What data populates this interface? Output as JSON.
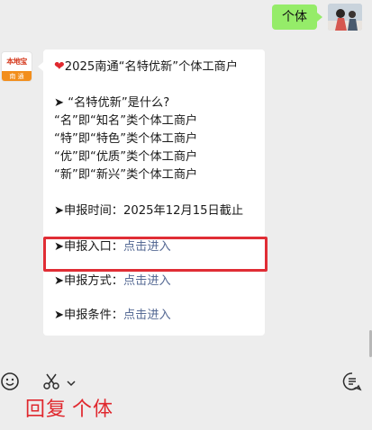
{
  "outgoing": {
    "text": "个体"
  },
  "bot": {
    "avatar_top": "本地宝",
    "avatar_bottom": "南 通"
  },
  "message": {
    "heart_icon": "heart-icon",
    "title": "2025南通“名特优新”个体工商户",
    "question": "➤ “名特优新”是什么?",
    "defs": [
      "“名”即“知名”类个体工商户",
      "“特”即“特色”类个体工商户",
      "“优”即“优质”类个体工商户",
      "“新”即“新兴”类个体工商户"
    ],
    "deadline": "➤申报时间：2025年12月15日截止",
    "entry_label": "➤申报入口：",
    "method_label": "➤申报方式：",
    "condition_label": "➤申报条件：",
    "link_text": "点击进入"
  },
  "toolbar": {
    "emoji": "emoji-icon",
    "scissors": "scissors-icon",
    "history": "chat-history-icon"
  },
  "reply": {
    "label": "回复",
    "name": "个体"
  },
  "colors": {
    "bubble_out": "#95ec69",
    "link": "#576b95",
    "highlight": "#e02d35",
    "reply": "#e0282e"
  }
}
